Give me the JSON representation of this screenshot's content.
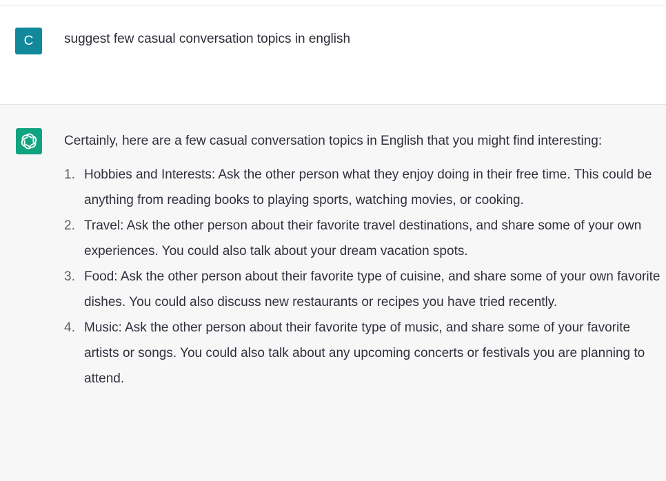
{
  "user_message": {
    "avatar_letter": "C",
    "text": "suggest few casual conversation topics in english"
  },
  "assistant_message": {
    "avatar_icon": "openai-logo-icon",
    "intro": "Certainly, here are a few casual conversation topics in English that you might find interesting:",
    "topics": [
      {
        "number": "1.",
        "text": "Hobbies and Interests: Ask the other person what they enjoy doing in their free time. This could be anything from reading books to playing sports, watching movies, or cooking."
      },
      {
        "number": "2.",
        "text": "Travel: Ask the other person about their favorite travel destinations, and share some of your own experiences. You could also talk about your dream vacation spots."
      },
      {
        "number": "3.",
        "text": "Food: Ask the other person about their favorite type of cuisine, and share some of your own favorite dishes. You could also discuss new restaurants or recipes you have tried recently."
      },
      {
        "number": "4.",
        "text": "Music: Ask the other person about their favorite type of music, and share some of your favorite artists or songs. You could also talk about any upcoming concerts or festivals you are planning to attend."
      }
    ]
  },
  "colors": {
    "user_avatar_bg": "#12899a",
    "bot_avatar_bg": "#10a37f",
    "assistant_bg": "#f7f7f8",
    "user_bg": "#ffffff"
  }
}
